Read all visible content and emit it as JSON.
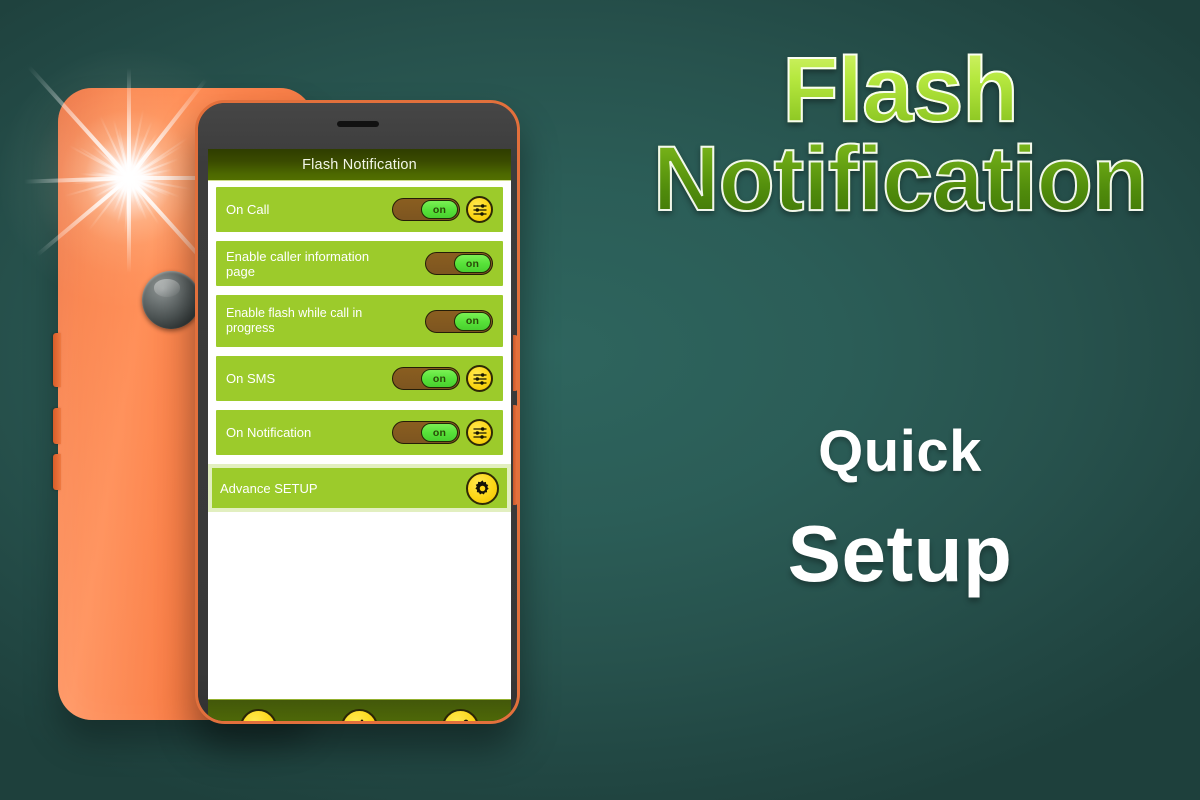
{
  "promo": {
    "title_line1": "Flash",
    "title_line2": "Notification",
    "sub_line1": "Quick",
    "sub_line2": "Setup",
    "title_gradient_top": "#d3f36b",
    "title_gradient_bottom": "#3f7508",
    "sub_color": "#ffffff"
  },
  "background": {
    "color_center": "#2e655e",
    "color_edge": "#1e403c"
  },
  "phone_back": {
    "body_color": "#fa7b40",
    "lens_name": "camera-lens",
    "flash_name": "camera-flash-burst"
  },
  "app": {
    "titlebar": {
      "title": "Flash Notification",
      "bg_top": "#2f3d00",
      "bg_bottom": "#526f00"
    },
    "row_color": "#9ccb2b",
    "toggle_on_label": "on",
    "rows": [
      {
        "label": "On Call",
        "toggle": "on",
        "has_settings": true,
        "two_line": false
      },
      {
        "label": "Enable caller information page",
        "toggle": "on",
        "has_settings": false,
        "two_line": false
      },
      {
        "label": "Enable flash while call in progress",
        "toggle": "on",
        "has_settings": false,
        "two_line": true
      },
      {
        "label": "On SMS",
        "toggle": "on",
        "has_settings": true,
        "two_line": false
      },
      {
        "label": "On Notification",
        "toggle": "on",
        "has_settings": true,
        "two_line": false
      }
    ],
    "advance_setup": {
      "label": "Advance SETUP",
      "icon": "gear-icon"
    },
    "action_bar": {
      "buttons": [
        {
          "name": "more-options-button",
          "icon": "ellipsis-icon"
        },
        {
          "name": "rate-app-button",
          "icon": "thumbs-up-icon"
        },
        {
          "name": "share-button",
          "icon": "share-icon"
        }
      ],
      "button_color": "#fcd616"
    },
    "nav_bar": {
      "buttons": [
        {
          "name": "android-back-button",
          "icon": "triangle-back-icon"
        },
        {
          "name": "android-home-button",
          "icon": "circle-home-icon"
        },
        {
          "name": "android-recents-button",
          "icon": "square-recents-icon"
        }
      ]
    }
  }
}
